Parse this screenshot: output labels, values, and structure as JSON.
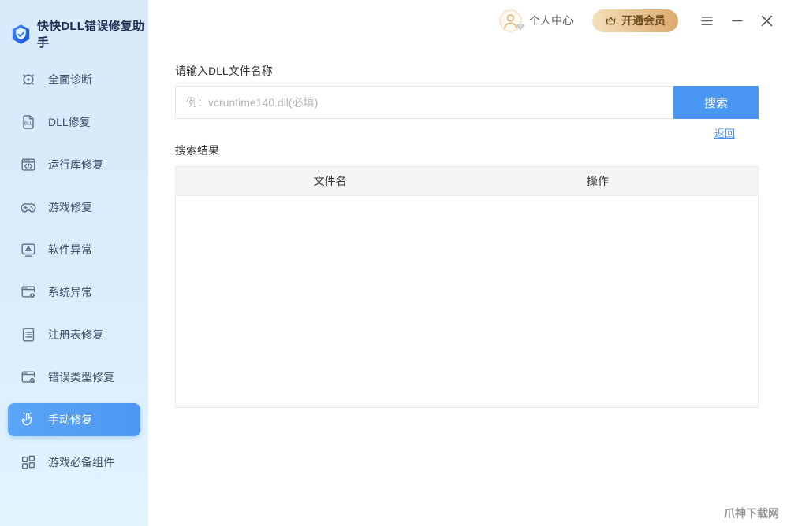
{
  "app": {
    "title": "快快DLL错误修复助手",
    "logo_icon": "shield-check-logo",
    "watermark": "爪神下载网"
  },
  "topbar": {
    "user_center_label": "个人中心",
    "avatar_icon": "person-avatar-icon",
    "avatar_badge_icon": "diamond-badge-icon",
    "vip_button_label": "开通会员",
    "vip_icon": "crown-icon",
    "menu_icon": "hamburger-menu-icon",
    "minimize_icon": "minimize-icon",
    "close_icon": "close-icon"
  },
  "sidebar": {
    "items": [
      {
        "label": "全面诊断",
        "icon": "diagnosis-target-icon",
        "active": false
      },
      {
        "label": "DLL修复",
        "icon": "dll-file-icon",
        "active": false
      },
      {
        "label": "运行库修复",
        "icon": "runtime-code-window-icon",
        "active": false
      },
      {
        "label": "游戏修复",
        "icon": "gamepad-icon",
        "active": false
      },
      {
        "label": "软件异常",
        "icon": "software-warning-icon",
        "active": false
      },
      {
        "label": "系统异常",
        "icon": "system-gear-window-icon",
        "active": false
      },
      {
        "label": "注册表修复",
        "icon": "registry-document-icon",
        "active": false
      },
      {
        "label": "错误类型修复",
        "icon": "error-type-window-icon",
        "active": false
      },
      {
        "label": "手动修复",
        "icon": "hand-pointer-icon",
        "active": true
      },
      {
        "label": "游戏必备组件",
        "icon": "components-grid-icon",
        "active": false
      }
    ]
  },
  "main": {
    "input_label": "请输入DLL文件名称",
    "input_value": "",
    "input_placeholder": "例：vcruntime140.dll(必填)",
    "search_button_label": "搜索",
    "back_link_label": "返回",
    "results_label": "搜索结果",
    "table": {
      "columns": [
        "文件名",
        "操作"
      ],
      "rows": []
    }
  },
  "colors": {
    "accent_blue": "#4a97f3",
    "sidebar_active_blue": "#53a0f4",
    "sidebar_bg_top": "#d9e9fa",
    "sidebar_bg_bottom": "#e2f4fe",
    "link_blue": "#4a90f0",
    "vip_gradient_start": "#f4e0ba",
    "vip_gradient_end": "#dcaa6e",
    "vip_text_brown": "#6b4a1d",
    "table_header_bg": "#f5f5f6"
  }
}
